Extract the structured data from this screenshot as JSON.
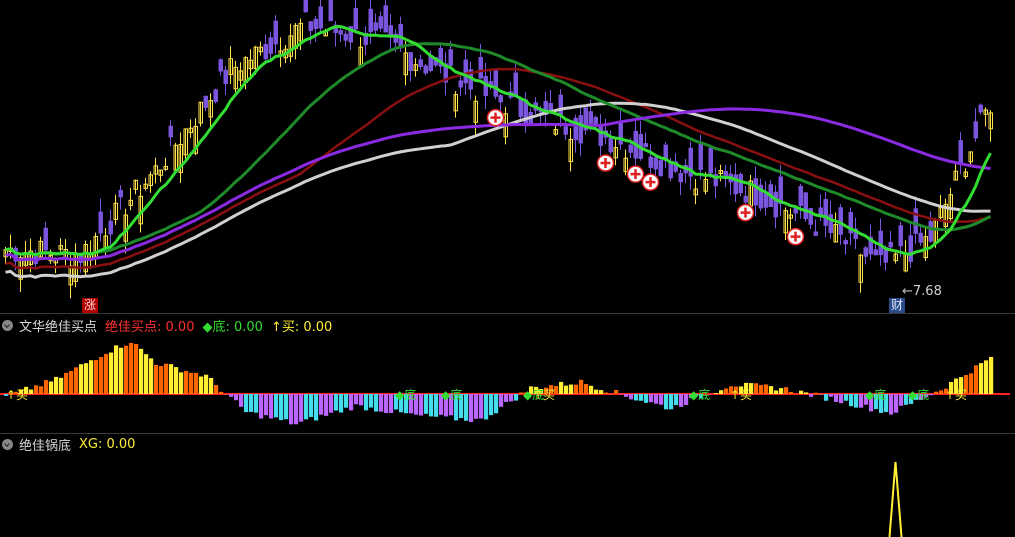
{
  "price_panel": {
    "low_price_label": "7.68",
    "badge_rise": "涨",
    "badge_finance": "财"
  },
  "indicator1": {
    "title": "文华绝佳买点",
    "buy_point_label": "绝佳买点: 0.00",
    "bottom_label": "◆底: 0.00",
    "buy_label": "↑买: 0.00",
    "marker_bottom": "底",
    "marker_buy": "买",
    "marker_buy_arrow": "↑买"
  },
  "indicator2": {
    "title": "绝佳锅底",
    "xg_label": "XG: 0.00"
  },
  "colors": {
    "up_candle": "#ffe24a",
    "down_candle": "#7b55dd",
    "ma_red": "#e01818",
    "ma_green": "#33dd33",
    "ma_darkred": "#8a1010",
    "ma_white": "#d0d0d0",
    "ma_darkgreen": "#1e8a2a",
    "ma_purple": "#8a2be2",
    "bar_orange": "#ff6600",
    "bar_yellow": "#ffee33",
    "bar_cyan": "#44ddee",
    "bar_violet": "#bb66ff",
    "zero_line": "#ff2020",
    "signal_yellow": "#ffee33"
  },
  "chart_data": [
    {
      "type": "candlestick",
      "description_series": [
        "price",
        "MA short (red/green)",
        "MA mid (dark red)",
        "MA long (white)",
        "MA dark green",
        "MA purple"
      ],
      "low_marker_value": 7.68,
      "trend_points": [
        {
          "i": 0,
          "close": 8.2
        },
        {
          "i": 15,
          "close": 8.1
        },
        {
          "i": 30,
          "close": 9.6
        },
        {
          "i": 45,
          "close": 11.4
        },
        {
          "i": 60,
          "close": 12.2
        },
        {
          "i": 75,
          "close": 11.9
        },
        {
          "i": 90,
          "close": 11.2
        },
        {
          "i": 105,
          "close": 10.6
        },
        {
          "i": 120,
          "close": 10.2
        },
        {
          "i": 135,
          "close": 9.6
        },
        {
          "i": 150,
          "close": 9.2
        },
        {
          "i": 165,
          "close": 8.5
        },
        {
          "i": 175,
          "close": 7.9
        },
        {
          "i": 185,
          "close": 8.4
        },
        {
          "i": 197,
          "close": 10.8
        }
      ]
    },
    {
      "type": "bar",
      "title": "文华绝佳买点",
      "values_note": "oscillator bars around zero",
      "trend_points": [
        {
          "i": 0,
          "v": -0.2
        },
        {
          "i": 10,
          "v": 1.2
        },
        {
          "i": 20,
          "v": 3.5
        },
        {
          "i": 25,
          "v": 4.4
        },
        {
          "i": 30,
          "v": 2.6
        },
        {
          "i": 40,
          "v": 1.5
        },
        {
          "i": 48,
          "v": -1.5
        },
        {
          "i": 58,
          "v": -2.5
        },
        {
          "i": 70,
          "v": -1.0
        },
        {
          "i": 82,
          "v": -1.8
        },
        {
          "i": 95,
          "v": -2.2
        },
        {
          "i": 105,
          "v": 0.5
        },
        {
          "i": 115,
          "v": 1.0
        },
        {
          "i": 125,
          "v": -0.3
        },
        {
          "i": 133,
          "v": -1.2
        },
        {
          "i": 145,
          "v": 0.8
        },
        {
          "i": 155,
          "v": 0.5
        },
        {
          "i": 165,
          "v": -0.4
        },
        {
          "i": 177,
          "v": -1.6
        },
        {
          "i": 187,
          "v": 0.4
        },
        {
          "i": 197,
          "v": 3.0
        }
      ]
    },
    {
      "type": "line",
      "title": "绝佳锅底",
      "series": [
        {
          "name": "XG",
          "values_note": "zero except spike near right end"
        }
      ],
      "spike_index": 178,
      "spike_value": 1
    }
  ]
}
